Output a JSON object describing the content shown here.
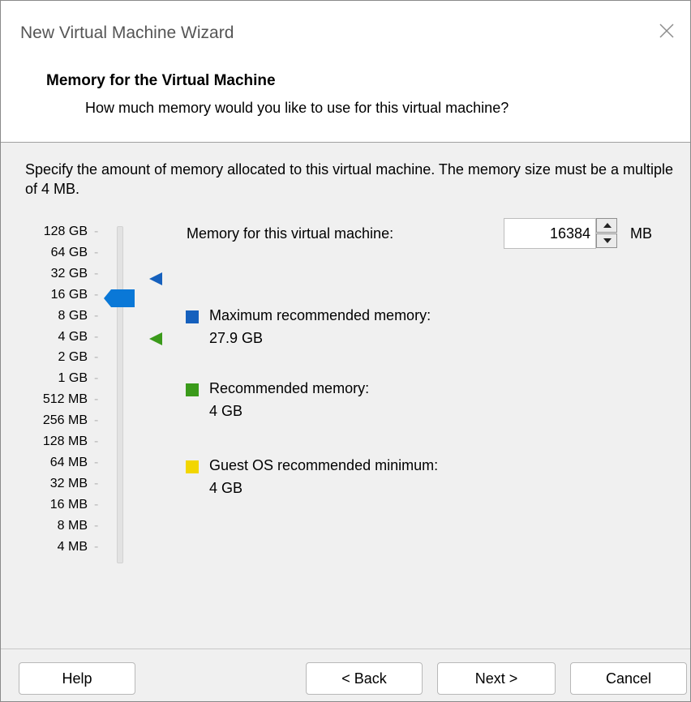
{
  "window": {
    "title": "New Virtual Machine Wizard",
    "close_icon": "close-icon"
  },
  "header": {
    "title": "Memory for the Virtual Machine",
    "subtitle": "How much memory would you like to use for this virtual machine?"
  },
  "body": {
    "description": "Specify the amount of memory allocated to this virtual machine. The memory size must be a multiple of 4 MB."
  },
  "memory": {
    "label": "Memory for this virtual machine:",
    "value": "16384",
    "unit": "MB",
    "spin_up_icon": "spin-up-icon",
    "spin_down_icon": "spin-down-icon"
  },
  "slider": {
    "scale": [
      "128 GB",
      "64 GB",
      "32 GB",
      "16 GB",
      "8 GB",
      "4 GB",
      "2 GB",
      "1 GB",
      "512 MB",
      "256 MB",
      "128 MB",
      "64 MB",
      "32 MB",
      "16 MB",
      "8 MB",
      "4 MB"
    ],
    "selected": "16 GB",
    "max_recommended_marker": "32 GB",
    "recommended_marker": "4 GB"
  },
  "legend": [
    {
      "label": "Maximum recommended memory:",
      "value": "27.9 GB",
      "color": "#1560bd"
    },
    {
      "label": "Recommended memory:",
      "value": "4 GB",
      "color": "#3a9a1a"
    },
    {
      "label": "Guest OS recommended minimum:",
      "value": "4 GB",
      "color": "#f2d600"
    }
  ],
  "colors": {
    "thumb": "#0a78d7",
    "max_marker": "#1560bd",
    "rec_marker": "#3a9a1a"
  },
  "buttons": {
    "help": "Help",
    "back": "< Back",
    "next": "Next >",
    "cancel": "Cancel"
  }
}
